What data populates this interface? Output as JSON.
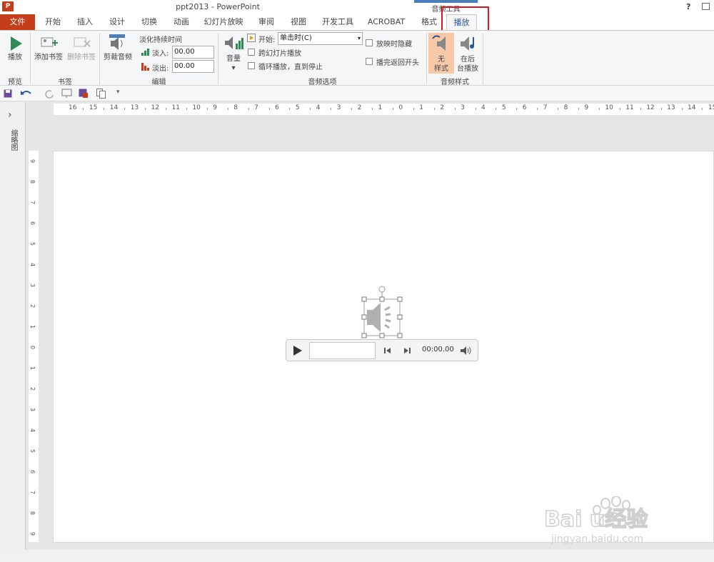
{
  "window": {
    "app_icon": "P",
    "title": "ppt2013 - PowerPoint",
    "context_group": "音频工具",
    "help": "?"
  },
  "tabs": [
    "文件",
    "开始",
    "插入",
    "设计",
    "切换",
    "动画",
    "幻灯片放映",
    "审阅",
    "视图",
    "开发工具",
    "ACROBAT",
    "格式",
    "播放"
  ],
  "active_tab": "播放",
  "ribbon": {
    "preview": {
      "play": "播放",
      "group": "预览"
    },
    "bookmarks": {
      "add": "添加书签",
      "remove": "删除书签",
      "group": "书签"
    },
    "editing": {
      "trim": "剪裁音频",
      "fade_title": "淡化持续时间",
      "fade_in_label": "淡入:",
      "fade_in_value": "00.00",
      "fade_out_label": "淡出:",
      "fade_out_value": "00.00",
      "group": "编辑"
    },
    "audio_options": {
      "volume": "音量",
      "start_label": "开始:",
      "start_value": "单击时(C)",
      "play_across": "跨幻灯片播放",
      "loop": "循环播放，直到停止",
      "hide": "放映时隐藏",
      "rewind": "播完返回开头",
      "group": "音频选项"
    },
    "audio_styles": {
      "no_style_1": "无",
      "no_style_2": "样式",
      "bg_1": "在后",
      "bg_2": "台播放",
      "group": "音频样式"
    }
  },
  "left_pane": {
    "label": "缩略图",
    "expand": "›"
  },
  "ruler": {
    "horizontal": [
      "16",
      "15",
      "14",
      "13",
      "12",
      "11",
      "10",
      "9",
      "8",
      "7",
      "6",
      "5",
      "4",
      "3",
      "2",
      "1",
      "0",
      "1",
      "2",
      "3",
      "4",
      "5",
      "6",
      "7",
      "8",
      "9",
      "10",
      "11",
      "12",
      "13",
      "14",
      "15"
    ],
    "vertical": [
      "9",
      "8",
      "7",
      "6",
      "5",
      "4",
      "3",
      "2",
      "1",
      "0",
      "1",
      "2",
      "3",
      "4",
      "5",
      "6",
      "7",
      "8",
      "9"
    ]
  },
  "player": {
    "time": "00:00.00",
    "progress": 0
  },
  "watermark": {
    "text": "Baidu经验",
    "sub": "jingyan.baidu.com"
  },
  "colors": {
    "file_tab": "#c43e1c",
    "accent": "#2b579a",
    "highlight": "#e0141e",
    "selected_style": "#f7c9a9"
  }
}
